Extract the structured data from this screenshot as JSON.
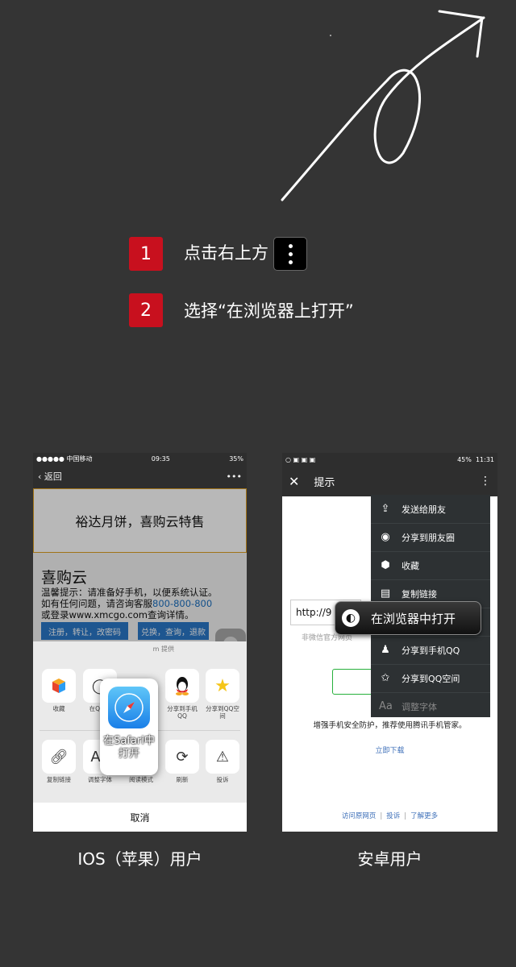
{
  "steps": [
    {
      "number": "1",
      "text": "点击右上方"
    },
    {
      "number": "2",
      "text": "选择“在浏览器上打开”"
    }
  ],
  "ios": {
    "status": {
      "carrier": "●●●●● 中国移动",
      "time": "09:35",
      "battery": "35%"
    },
    "nav": {
      "back": "返回",
      "more": "•••"
    },
    "banner": "裕达月饼，喜购云特售",
    "shop_title": "喜购云",
    "notice_line1": "温馨提示：请准备好手机，以便系统认证。",
    "notice_line2_pre": "如有任何问题，请咨询客服",
    "notice_phone": "800-800-800",
    "notice_line3": "或登录www.xmcgo.com查询详情。",
    "buttons": [
      "注册，转让，改密码",
      "兑换，查询，退款"
    ],
    "sheet_source": "m 提供",
    "row1": [
      {
        "label": "收藏",
        "icon": "cube-icon"
      },
      {
        "label": "在QQ中",
        "icon": "browser-icon"
      },
      {
        "label": "分享到手机QQ",
        "icon": "qq-icon"
      },
      {
        "label": "分享到QQ空间",
        "icon": "qzone-icon"
      }
    ],
    "row2": [
      {
        "label": "复制链接",
        "icon": "link-icon"
      },
      {
        "label": "调整字体",
        "icon": "font-icon",
        "glyph": "Aa"
      },
      {
        "label": "阅读模式",
        "icon": "book-icon"
      },
      {
        "label": "刷新",
        "icon": "refresh-icon"
      },
      {
        "label": "投诉",
        "icon": "warning-icon"
      }
    ],
    "safari_label": "在Safari中打开",
    "cancel": "取消"
  },
  "android": {
    "status": {
      "battery": "45%",
      "time": "11:31"
    },
    "nav_title": "提示",
    "url_text": "http://9",
    "url_hint": "非微信官方网页",
    "menu": [
      {
        "label": "发送给朋友",
        "icon": "share-icon"
      },
      {
        "label": "分享到朋友圈",
        "icon": "moments-icon"
      },
      {
        "label": "收藏",
        "icon": "cube-icon"
      },
      {
        "label": "复制链接",
        "icon": "doc-icon"
      },
      {
        "label": "",
        "icon": "globe-icon"
      },
      {
        "label": "分享到手机QQ",
        "icon": "qq-icon"
      },
      {
        "label": "分享到QQ空间",
        "icon": "qzone-icon"
      },
      {
        "label": "调整字体",
        "icon": "font-icon"
      }
    ],
    "open_in_browser": "在浏览器中打开",
    "guard_text": "增强手机安全防护，推荐使用腾讯手机管家。",
    "download": "立即下载",
    "footer": [
      "访问原网页",
      "投诉",
      "了解更多"
    ]
  },
  "captions": {
    "ios": "IOS（苹果）用户",
    "android": "安卓用户"
  },
  "colors": {
    "background": "#343434",
    "badge": "#c8101e",
    "link": "#3d6fb8"
  }
}
